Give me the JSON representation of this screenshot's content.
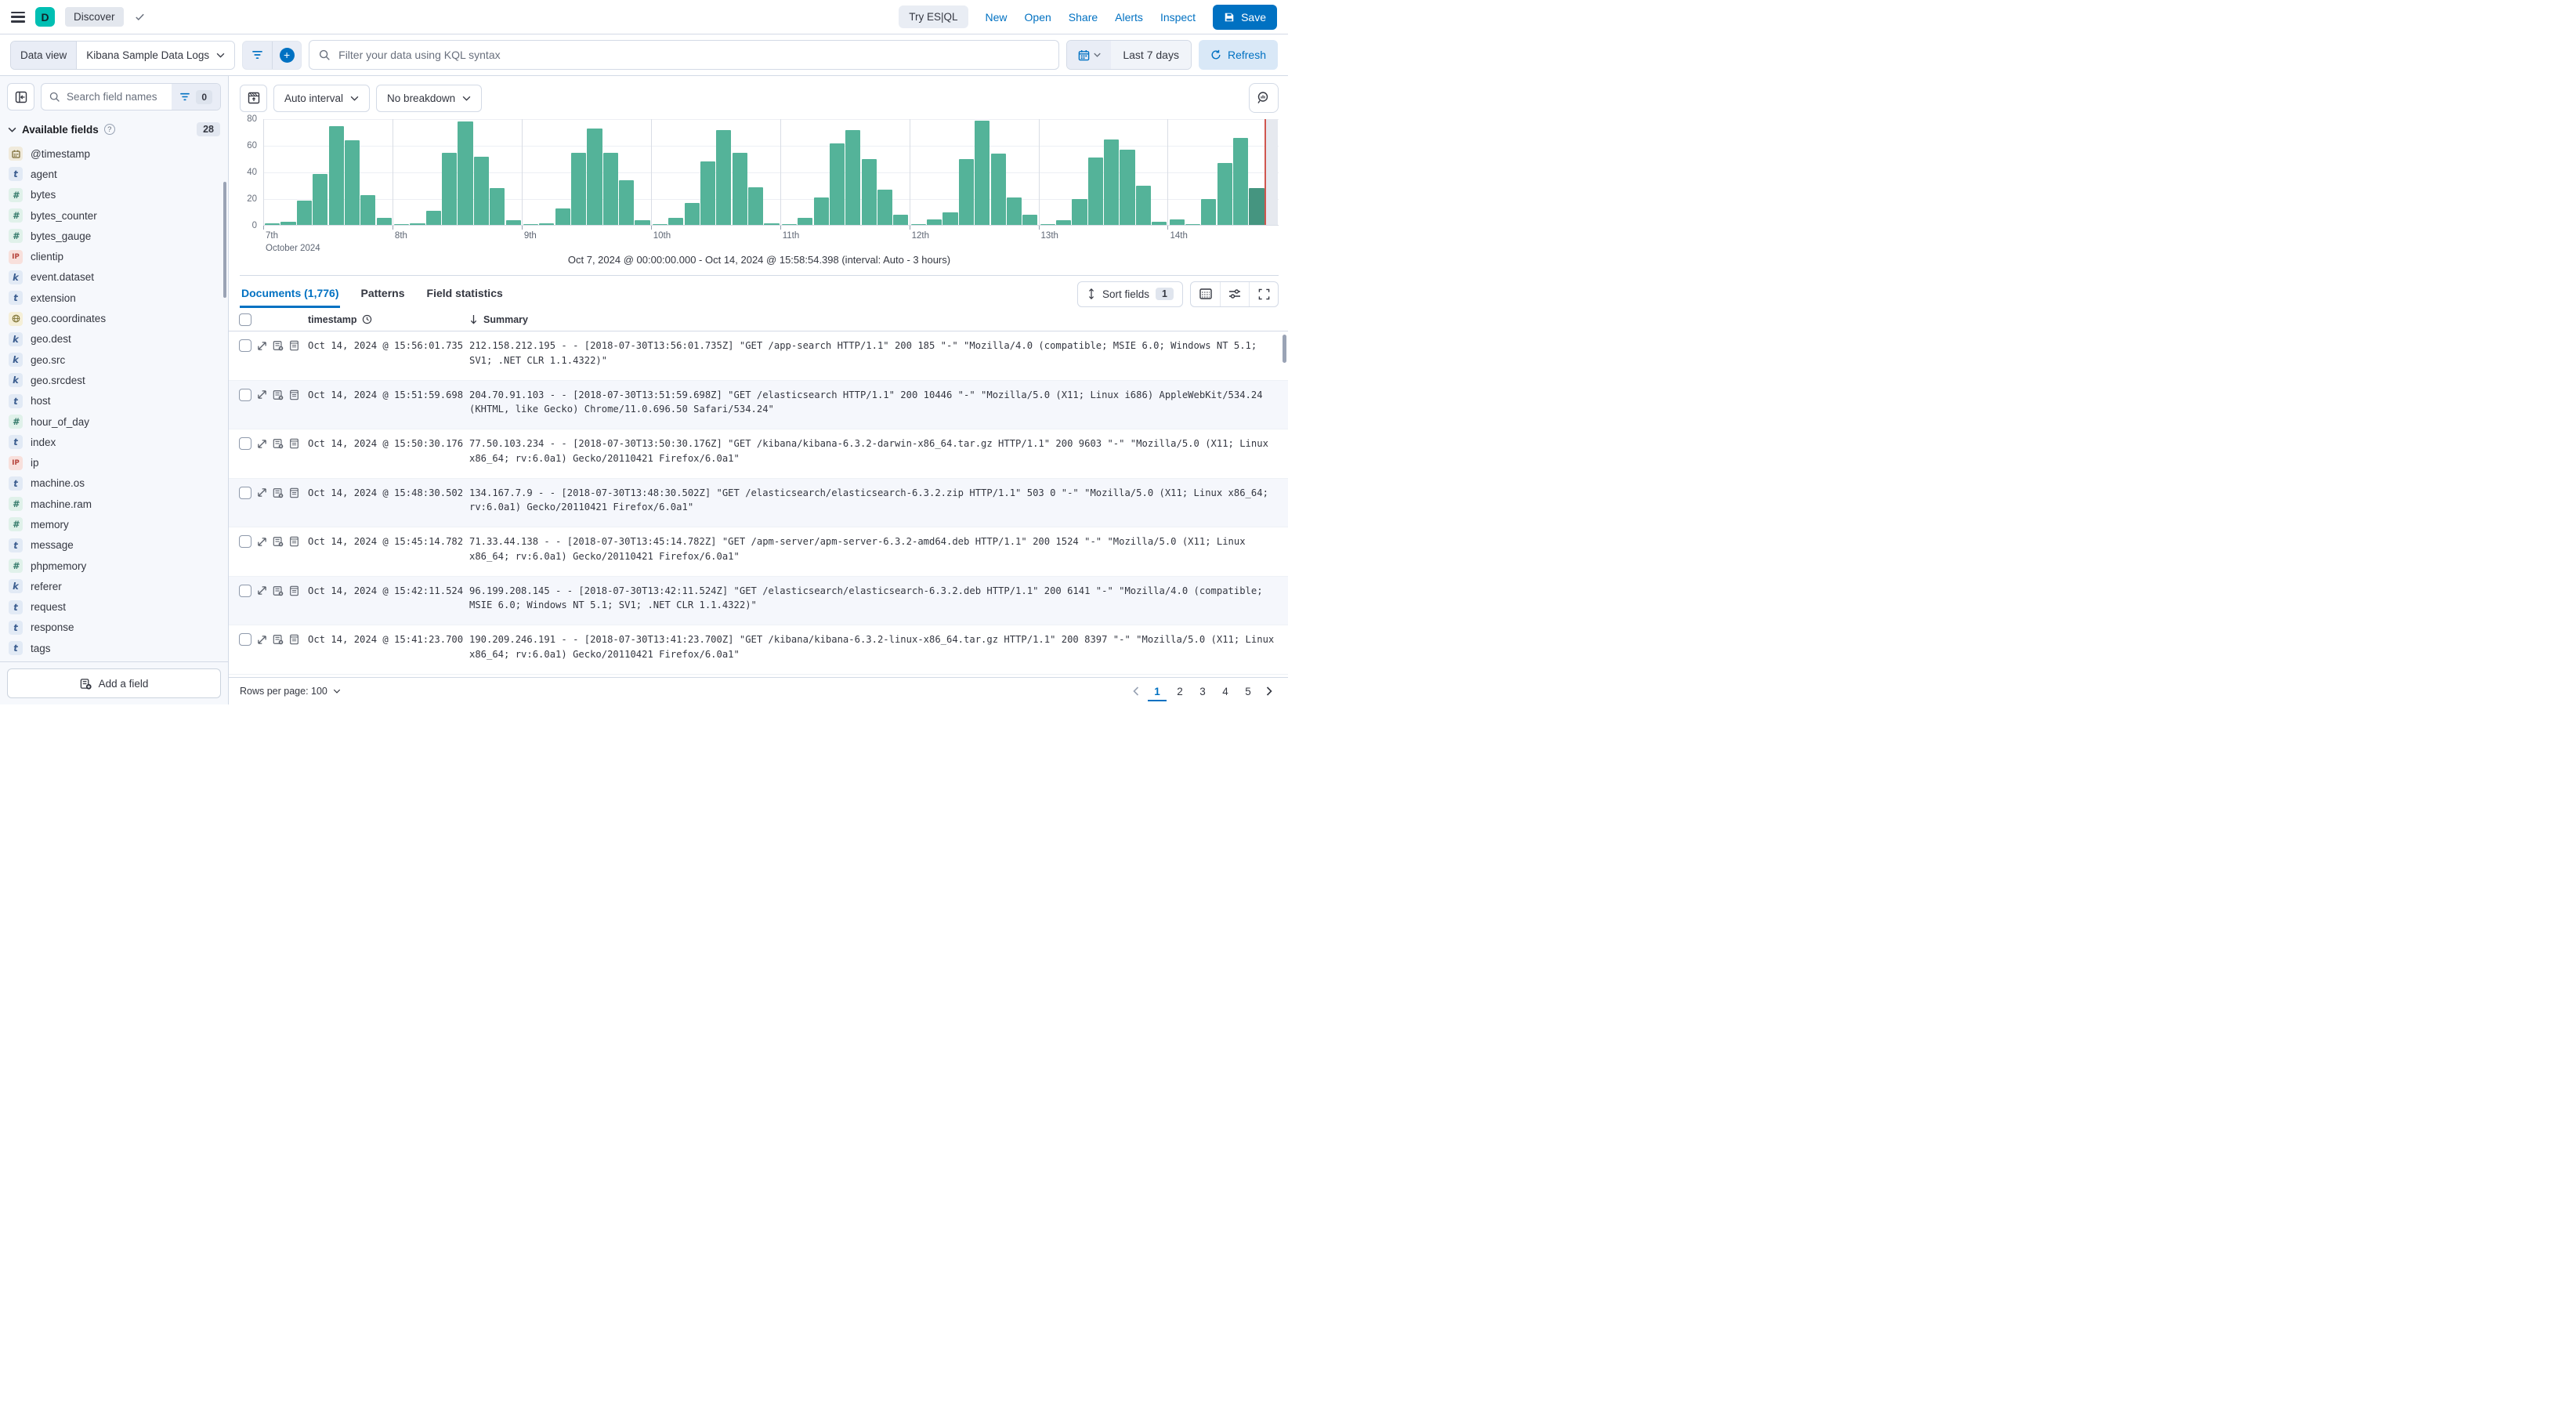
{
  "header": {
    "app_initial": "D",
    "breadcrumb": "Discover",
    "try_esql_label": "Try ES|QL",
    "links": [
      "New",
      "Open",
      "Share",
      "Alerts",
      "Inspect"
    ],
    "save_label": "Save"
  },
  "toolbar": {
    "data_view_label": "Data view",
    "data_view_value": "Kibana Sample Data Logs",
    "search_placeholder": "Filter your data using KQL syntax",
    "time_range": "Last 7 days",
    "refresh_label": "Refresh"
  },
  "sidebar": {
    "search_placeholder": "Search field names",
    "filter_count": "0",
    "section_title": "Available fields",
    "field_count": "28",
    "add_field_label": "Add a field",
    "fields": [
      {
        "name": "@timestamp",
        "type": "date"
      },
      {
        "name": "agent",
        "type": "text"
      },
      {
        "name": "bytes",
        "type": "number"
      },
      {
        "name": "bytes_counter",
        "type": "number"
      },
      {
        "name": "bytes_gauge",
        "type": "number"
      },
      {
        "name": "clientip",
        "type": "ip"
      },
      {
        "name": "event.dataset",
        "type": "keyword"
      },
      {
        "name": "extension",
        "type": "text"
      },
      {
        "name": "geo.coordinates",
        "type": "geo_point"
      },
      {
        "name": "geo.dest",
        "type": "keyword"
      },
      {
        "name": "geo.src",
        "type": "keyword"
      },
      {
        "name": "geo.srcdest",
        "type": "keyword"
      },
      {
        "name": "host",
        "type": "text"
      },
      {
        "name": "hour_of_day",
        "type": "number"
      },
      {
        "name": "index",
        "type": "text"
      },
      {
        "name": "ip",
        "type": "ip"
      },
      {
        "name": "machine.os",
        "type": "text"
      },
      {
        "name": "machine.ram",
        "type": "number"
      },
      {
        "name": "memory",
        "type": "number"
      },
      {
        "name": "message",
        "type": "text"
      },
      {
        "name": "phpmemory",
        "type": "number"
      },
      {
        "name": "referer",
        "type": "keyword"
      },
      {
        "name": "request",
        "type": "text"
      },
      {
        "name": "response",
        "type": "text"
      },
      {
        "name": "tags",
        "type": "text"
      }
    ],
    "type_styles": {
      "date": {
        "bg": "#F0EADB",
        "fg": "#7A6A33"
      },
      "text": {
        "bg": "#E2EAF5",
        "fg": "#3B5D8F"
      },
      "keyword": {
        "bg": "#E2EAF5",
        "fg": "#3B5D8F"
      },
      "number": {
        "bg": "#E0F1EA",
        "fg": "#357A6B"
      },
      "ip": {
        "bg": "#F8E0DC",
        "fg": "#B5423A"
      },
      "geo_point": {
        "bg": "#F5EFD7",
        "fg": "#857A3D"
      }
    }
  },
  "chart": {
    "interval_label": "Auto interval",
    "breakdown_label": "No breakdown",
    "caption": "Oct 7, 2024 @ 00:00:00.000 - Oct 14, 2024 @ 15:58:54.398 (interval: Auto - 3 hours)"
  },
  "chart_data": {
    "type": "bar",
    "title": "Document count histogram",
    "xlabel": "October 2024",
    "ylabel": "",
    "ylim": [
      0,
      80
    ],
    "y_ticks": [
      0,
      20,
      40,
      60,
      80
    ],
    "grid": true,
    "bar_color": "#54B399",
    "partial_bar_color": "#459580",
    "marker_color": "#D0564F",
    "partial_last_bar": true,
    "days": [
      {
        "label": "7th",
        "sublabel": "October 2024",
        "values": [
          2,
          3,
          19,
          39,
          75,
          64,
          23,
          6
        ]
      },
      {
        "label": "8th",
        "values": [
          1,
          2,
          11,
          55,
          78,
          52,
          28,
          4
        ]
      },
      {
        "label": "9th",
        "values": [
          1,
          2,
          13,
          55,
          73,
          55,
          34,
          4
        ]
      },
      {
        "label": "10th",
        "values": [
          1,
          6,
          17,
          48,
          72,
          55,
          29,
          2
        ]
      },
      {
        "label": "11th",
        "values": [
          1,
          6,
          21,
          62,
          72,
          50,
          27,
          8
        ]
      },
      {
        "label": "12th",
        "values": [
          1,
          5,
          10,
          50,
          79,
          54,
          21,
          8
        ]
      },
      {
        "label": "13th",
        "values": [
          1,
          4,
          20,
          51,
          65,
          57,
          30,
          3
        ]
      },
      {
        "label": "14th",
        "values": [
          5,
          1,
          20,
          47,
          66,
          28
        ]
      }
    ]
  },
  "results": {
    "tabs": [
      {
        "label": "Documents (1,776)",
        "active": true
      },
      {
        "label": "Patterns",
        "active": false
      },
      {
        "label": "Field statistics",
        "active": false
      }
    ],
    "sort_fields_label": "Sort fields",
    "sort_fields_count": "1",
    "columns": {
      "timestamp": "timestamp",
      "summary": "Summary"
    },
    "rows": [
      {
        "timestamp": "Oct 14, 2024 @ 15:56:01.735",
        "summary": "212.158.212.195 - - [2018-07-30T13:56:01.735Z] \"GET /app-search HTTP/1.1\" 200 185 \"-\" \"Mozilla/4.0 (compatible; MSIE 6.0; Windows NT 5.1; SV1; .NET CLR 1.1.4322)\""
      },
      {
        "timestamp": "Oct 14, 2024 @ 15:51:59.698",
        "summary": "204.70.91.103 - - [2018-07-30T13:51:59.698Z] \"GET /elasticsearch HTTP/1.1\" 200 10446 \"-\" \"Mozilla/5.0 (X11; Linux i686) AppleWebKit/534.24 (KHTML, like Gecko) Chrome/11.0.696.50 Safari/534.24\""
      },
      {
        "timestamp": "Oct 14, 2024 @ 15:50:30.176",
        "summary": "77.50.103.234 - - [2018-07-30T13:50:30.176Z] \"GET /kibana/kibana-6.3.2-darwin-x86_64.tar.gz HTTP/1.1\" 200 9603 \"-\" \"Mozilla/5.0 (X11; Linux x86_64; rv:6.0a1) Gecko/20110421 Firefox/6.0a1\""
      },
      {
        "timestamp": "Oct 14, 2024 @ 15:48:30.502",
        "summary": "134.167.7.9 - - [2018-07-30T13:48:30.502Z] \"GET /elasticsearch/elasticsearch-6.3.2.zip HTTP/1.1\" 503 0 \"-\" \"Mozilla/5.0 (X11; Linux x86_64; rv:6.0a1) Gecko/20110421 Firefox/6.0a1\""
      },
      {
        "timestamp": "Oct 14, 2024 @ 15:45:14.782",
        "summary": "71.33.44.138 - - [2018-07-30T13:45:14.782Z] \"GET /apm-server/apm-server-6.3.2-amd64.deb HTTP/1.1\" 200 1524 \"-\" \"Mozilla/5.0 (X11; Linux x86_64; rv:6.0a1) Gecko/20110421 Firefox/6.0a1\""
      },
      {
        "timestamp": "Oct 14, 2024 @ 15:42:11.524",
        "summary": "96.199.208.145 - - [2018-07-30T13:42:11.524Z] \"GET /elasticsearch/elasticsearch-6.3.2.deb HTTP/1.1\" 200 6141 \"-\" \"Mozilla/4.0 (compatible; MSIE 6.0; Windows NT 5.1; SV1; .NET CLR 1.1.4322)\""
      },
      {
        "timestamp": "Oct 14, 2024 @ 15:41:23.700",
        "summary": "190.209.246.191 - - [2018-07-30T13:41:23.700Z] \"GET /kibana/kibana-6.3.2-linux-x86_64.tar.gz HTTP/1.1\" 200 8397 \"-\" \"Mozilla/5.0 (X11; Linux x86_64; rv:6.0a1) Gecko/20110421 Firefox/6.0a1\""
      }
    ]
  },
  "footer": {
    "rows_per_page_label": "Rows per page: 100",
    "pages": [
      "1",
      "2",
      "3",
      "4",
      "5"
    ],
    "active_page": "1"
  },
  "colors": {
    "accent": "#0071C2",
    "brand_teal": "#00BFB3",
    "border": "#D3DAE6",
    "stripe": "#F5F7FC"
  }
}
